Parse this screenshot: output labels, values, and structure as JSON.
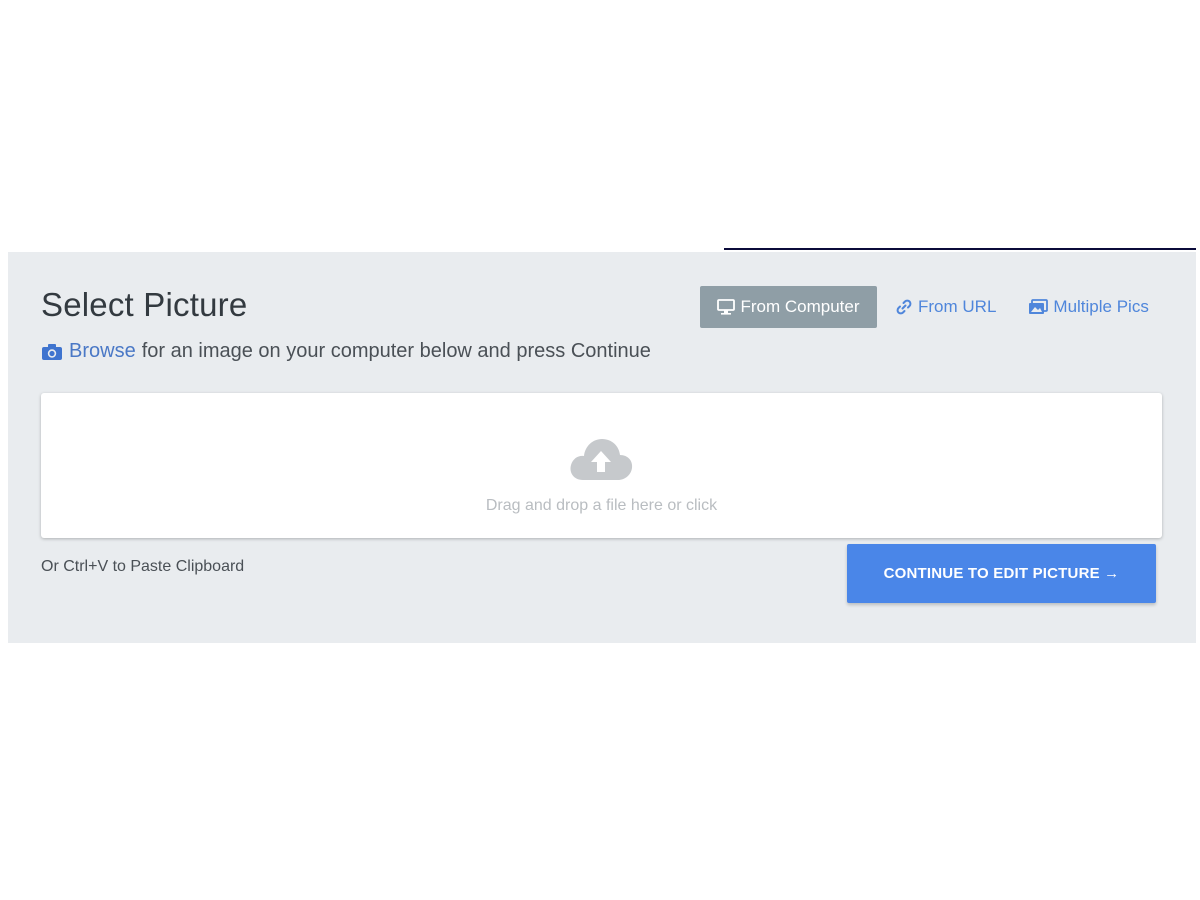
{
  "header": {
    "title": "Select Picture",
    "subtitle_link": "Browse",
    "subtitle_rest": "for an image on your computer below and press Continue"
  },
  "tabs": [
    {
      "label": "From Computer",
      "icon": "monitor-icon",
      "active": true
    },
    {
      "label": "From URL",
      "icon": "link-icon",
      "active": false
    },
    {
      "label": "Multiple Pics",
      "icon": "images-icon",
      "active": false
    }
  ],
  "dropzone": {
    "icon": "cloud-upload-icon",
    "text": "Drag and drop a file here or click"
  },
  "paste_hint": "Or Ctrl+V to Paste Clipboard",
  "continue_button": {
    "label": "CONTINUE TO EDIT PICTURE →"
  },
  "colors": {
    "panel_bg": "#e9ecef",
    "accent": "#4a86e8",
    "link": "#4f86db",
    "active_tab": "#8f9ea6"
  }
}
